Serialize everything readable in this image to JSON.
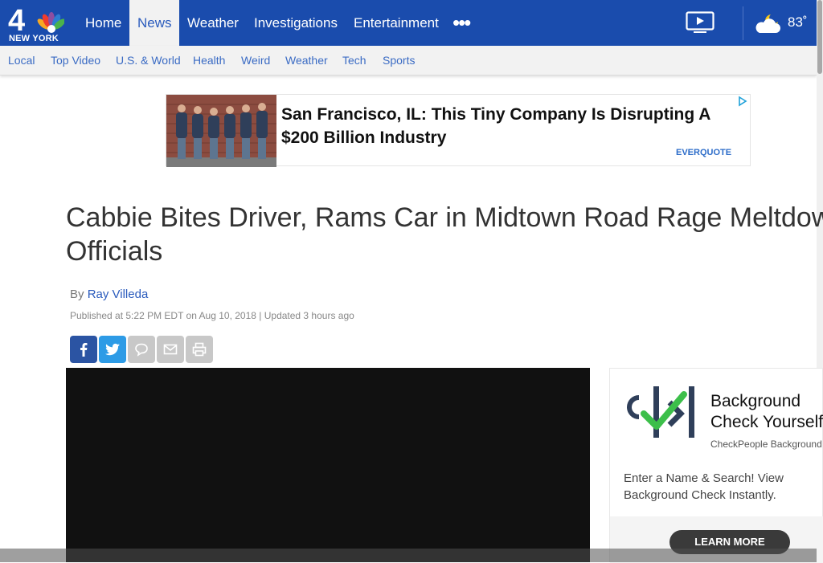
{
  "header": {
    "logo_text": "NEW YORK",
    "nav": [
      "Home",
      "News",
      "Weather",
      "Investigations",
      "Entertainment"
    ],
    "active_nav": "News",
    "more_label": "•••",
    "temperature": "83˚",
    "colors": {
      "brand": "#1a4cad",
      "link": "#2a5bbd"
    }
  },
  "subnav": [
    "Local",
    "Top Video",
    "U.S. & World",
    "Health",
    "Weird",
    "Weather",
    "Tech",
    "Sports"
  ],
  "top_ad": {
    "headline": "San Francisco, IL: This Tiny Company Is Disrupting A $200 Billion Industry",
    "brand": "EVERQUOTE"
  },
  "article": {
    "title": "Cabbie Bites Driver, Rams Car in Midtown Road Rage Meltdown: Officials",
    "byline_prefix": "By",
    "author": "Ray Villeda",
    "published": "Published at 5:22 PM EDT on Aug 10, 2018 | Updated 3 hours ago"
  },
  "share_buttons": [
    "facebook-icon",
    "twitter-icon",
    "comment-icon",
    "email-icon",
    "print-icon"
  ],
  "side_ad": {
    "title": "Background Check Yourself",
    "sponsor": "CheckPeople Background",
    "body": "Enter a Name & Search! View Background Check Instantly.",
    "button": "LEARN MORE"
  }
}
